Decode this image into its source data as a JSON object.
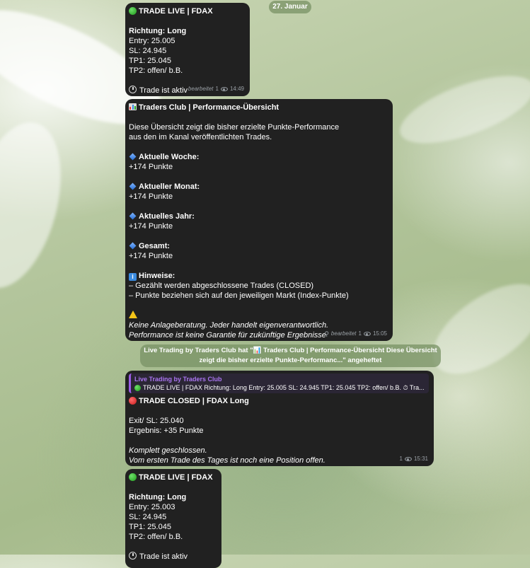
{
  "date_pill": "27. Januar",
  "msg1": {
    "lines": [
      "TRADE LIVE | FDAX",
      "",
      "Richtung: Long",
      "Entry: 25.005",
      "SL: 24.945",
      "TP1: 25.045",
      "TP2: offen/ b.B.",
      "",
      "Trade ist aktiv"
    ],
    "edited": "bearbeitet",
    "views": "1",
    "time": "14:49"
  },
  "msg2": {
    "title": "Traders Club | Performance-Übersicht",
    "intro1": "Diese Übersicht zeigt die bisher erzielte Punkte-Performance",
    "intro2": "aus den im Kanal veröffentlichten Trades.",
    "week_label": "Aktuelle Woche:",
    "week_value": "+174 Punkte",
    "month_label": "Aktueller Monat:",
    "month_value": "+174 Punkte",
    "year_label": "Aktuelles Jahr:",
    "year_value": "+174 Punkte",
    "total_label": "Gesamt:",
    "total_value": "+174 Punkte",
    "notes_label": "Hinweise:",
    "note1": "– Gezählt werden abgeschlossene Trades (CLOSED)",
    "note2": "– Punkte beziehen sich auf den jeweiligen Markt (Index-Punkte)",
    "disclaimer1": "Keine Anlageberatung. Jeder handelt eigenverantwortlich.",
    "disclaimer2": "Performance ist keine Garantie für zukünftige Ergebnisse",
    "edited": "bearbeitet",
    "views": "1",
    "time": "15:05"
  },
  "pin_notice": {
    "line1": "Live Trading by Traders Club hat \"📊 Traders Club | Performance-Übersicht Diese Übersicht",
    "line2": "zeigt die bisher erzielte Punkte-Performanc...\" angeheftet"
  },
  "msg3": {
    "reply_author": "Live Trading by Traders Club",
    "reply_text": "TRADE LIVE | FDAX Richtung: Long Entry: 25.005 SL: 24.945 TP1: 25.045 TP2: offen/ b.B. ⏱ Tra...",
    "title": "TRADE CLOSED | FDAX Long",
    "exit": "Exit/ SL: 25.040",
    "result": "Ergebnis: +35 Punkte",
    "note1": "Komplett geschlossen.",
    "note2": "Vom ersten Trade des Tages ist noch eine Position offen.",
    "views": "1",
    "time": "15:31"
  },
  "msg4": {
    "lines": [
      "TRADE LIVE | FDAX",
      "",
      "Richtung: Long",
      "Entry: 25.003",
      "SL: 24.945",
      "TP1: 25.045",
      "TP2: offen/ b.B.",
      "",
      "Trade ist aktiv"
    ]
  },
  "colors": {
    "bubble": "#212121",
    "accent_purple": "#9b5de5",
    "meta_gray": "#9aa0a6"
  }
}
